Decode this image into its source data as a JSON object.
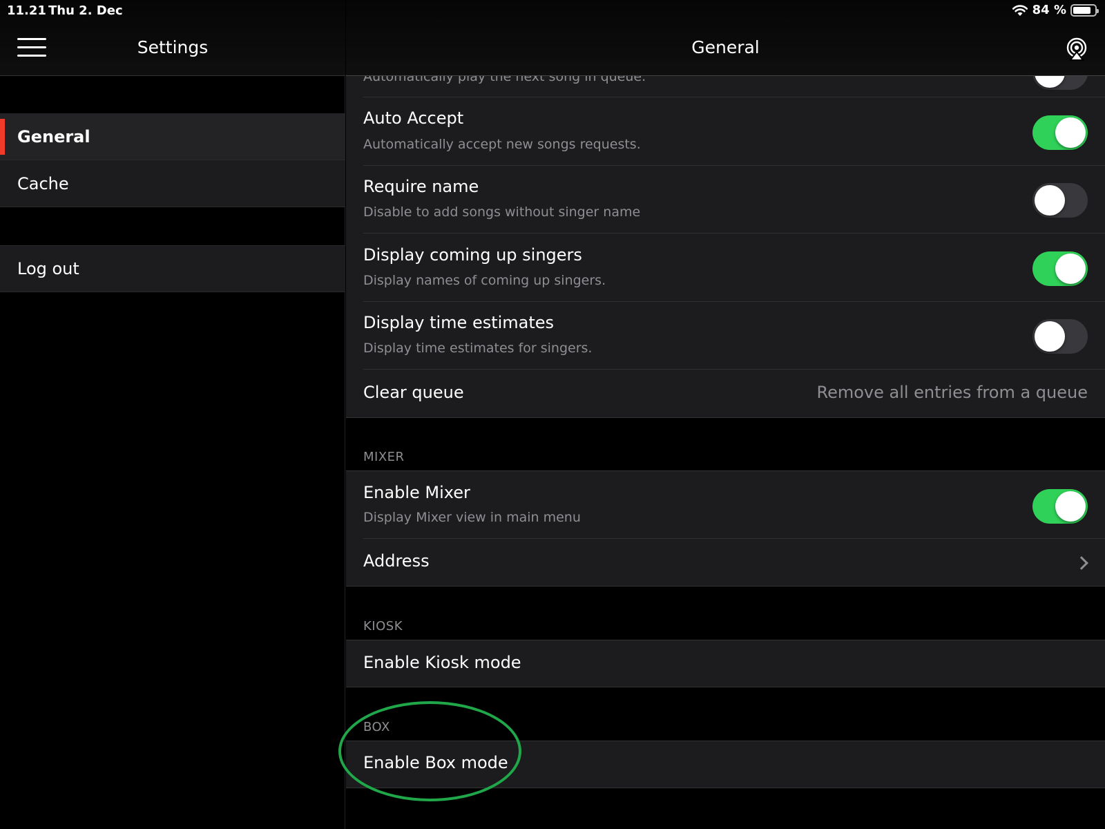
{
  "status_bar": {
    "time": "11.21",
    "date": "Thu 2. Dec",
    "battery_percent": "84 %",
    "battery_level": 0.84,
    "wifi_icon": "wifi-icon"
  },
  "sidebar": {
    "title": "Settings",
    "menu_icon": "hamburger-menu-icon",
    "items": [
      {
        "label": "General",
        "active": true
      },
      {
        "label": "Cache",
        "active": false
      }
    ],
    "logout_label": "Log out",
    "accent_color": "#f03a2a"
  },
  "detail": {
    "title": "General",
    "airplay_icon": "airplay-icon",
    "partial_row_sub": "Automatically play the next song in queue.",
    "rows": [
      {
        "title": "Auto Accept",
        "subtitle": "Automatically accept new songs requests.",
        "toggle_on": true
      },
      {
        "title": "Require name",
        "subtitle": "Disable to add songs without singer name",
        "toggle_on": false
      },
      {
        "title": "Display coming up singers",
        "subtitle": "Display names of coming up singers.",
        "toggle_on": true
      },
      {
        "title": "Display time estimates",
        "subtitle": "Display time estimates for singers.",
        "toggle_on": false
      }
    ],
    "clear_queue": {
      "title": "Clear queue",
      "value": "Remove all entries from a queue"
    },
    "mixer": {
      "header": "MIXER",
      "enable_title": "Enable Mixer",
      "enable_subtitle": "Display Mixer view in main menu",
      "enable_on": true,
      "address_title": "Address"
    },
    "kiosk": {
      "header": "KIOSK",
      "enable_title": "Enable Kiosk mode"
    },
    "box": {
      "header": "BOX",
      "enable_title": "Enable Box mode"
    },
    "toggle_on_color": "#30d158",
    "highlight_color": "#1fa74a"
  }
}
